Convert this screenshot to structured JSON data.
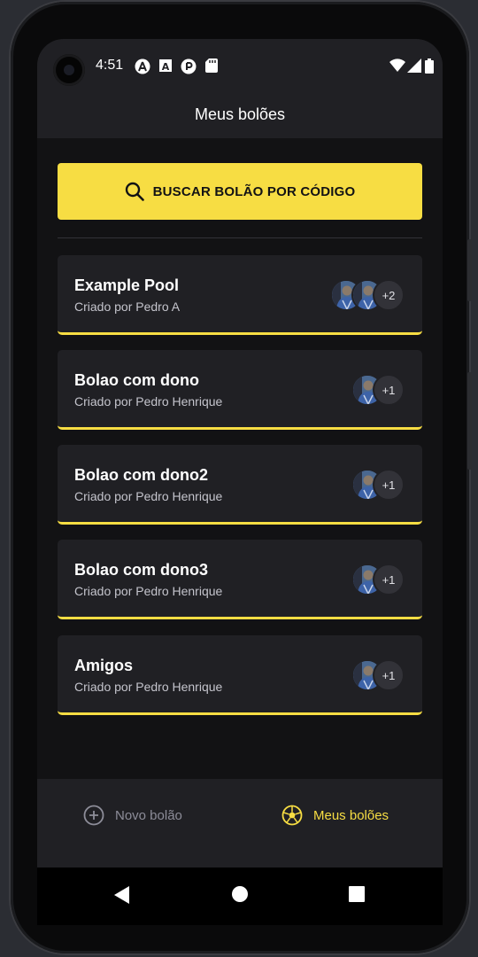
{
  "status_bar": {
    "time": "4:51",
    "icons": [
      "react-icon",
      "font-icon",
      "circle-p-icon",
      "sd-card-icon"
    ],
    "system_icons": [
      "wifi-icon",
      "signal-icon",
      "battery-icon"
    ]
  },
  "header": {
    "title": "Meus bolões"
  },
  "search": {
    "label": "BUSCAR BOLÃO POR CÓDIGO",
    "icon": "search-icon"
  },
  "pools": [
    {
      "title": "Example Pool",
      "owner": "Criado por Pedro A",
      "avatars": 2,
      "extra": "+2"
    },
    {
      "title": "Bolao com dono",
      "owner": "Criado por Pedro Henrique",
      "avatars": 1,
      "extra": "+1"
    },
    {
      "title": "Bolao com dono2",
      "owner": "Criado por Pedro Henrique",
      "avatars": 1,
      "extra": "+1"
    },
    {
      "title": "Bolao com dono3",
      "owner": "Criado por Pedro Henrique",
      "avatars": 1,
      "extra": "+1"
    },
    {
      "title": "Amigos",
      "owner": "Criado por Pedro Henrique",
      "avatars": 1,
      "extra": "+1"
    }
  ],
  "tabs": {
    "new_pool": {
      "label": "Novo bolão",
      "icon": "plus-circle-icon"
    },
    "my_pools": {
      "label": "Meus bolões",
      "icon": "soccer-ball-icon",
      "active": true
    }
  },
  "colors": {
    "accent": "#f7dd43",
    "background": "#121214",
    "card": "#202024",
    "inactive_text": "#8d8d99"
  }
}
